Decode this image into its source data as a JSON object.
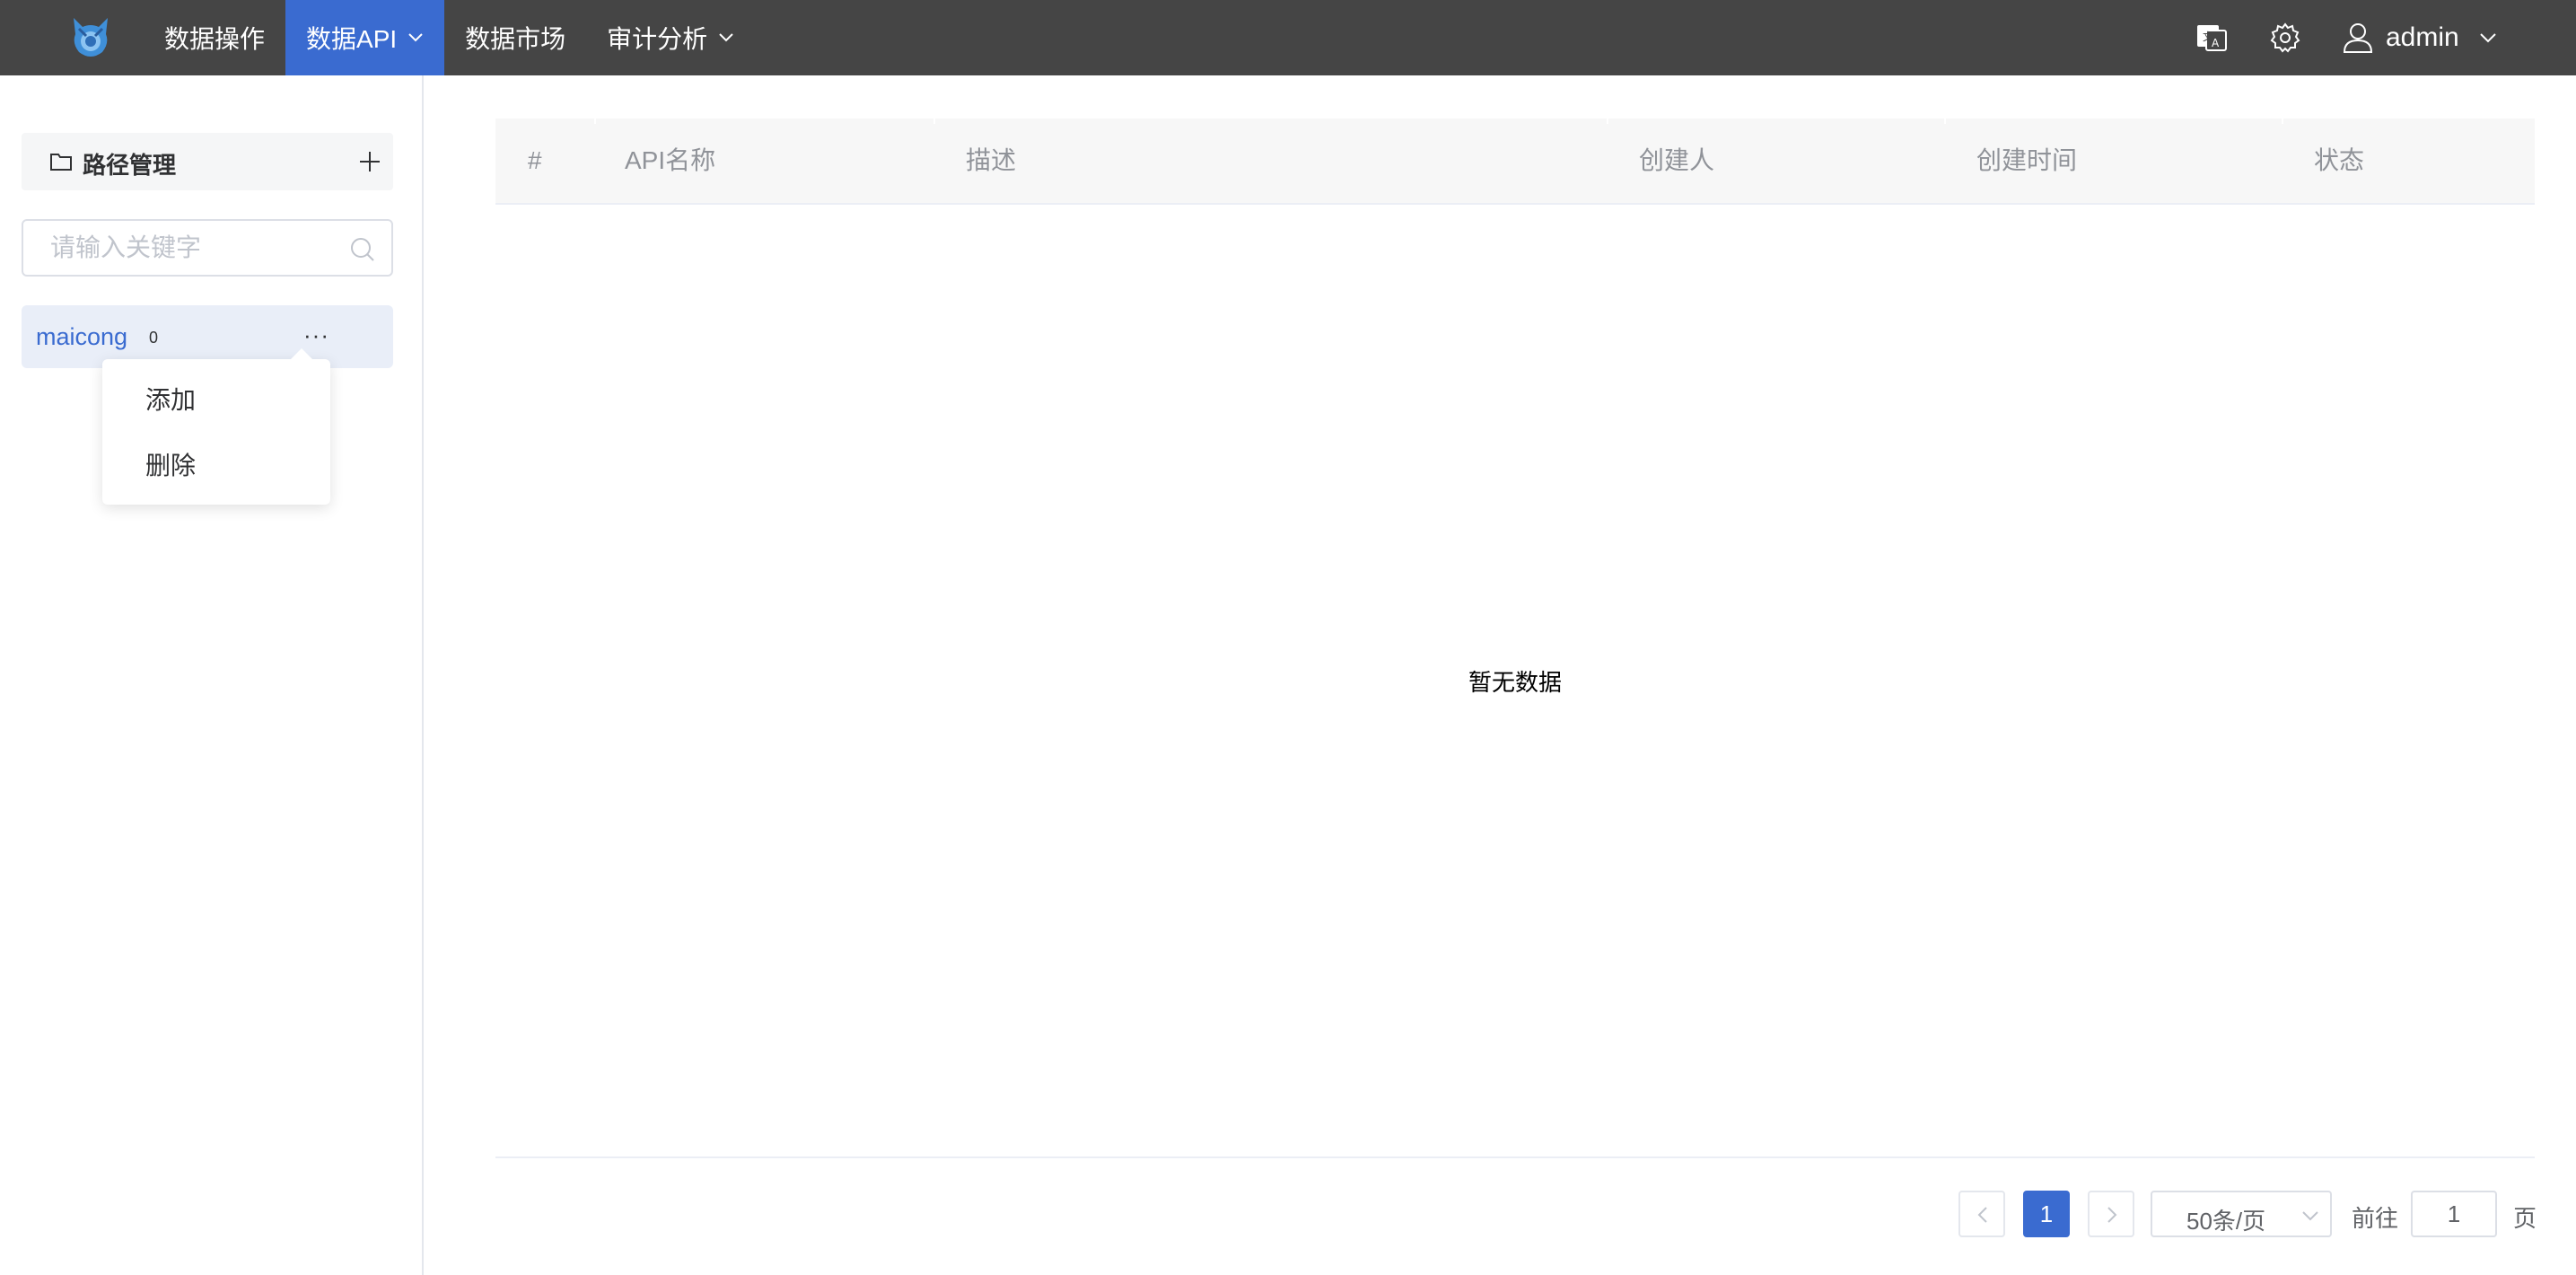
{
  "topbar": {
    "nav": [
      {
        "label": "数据操作",
        "active": false,
        "has_dropdown": false
      },
      {
        "label": "数据API",
        "active": true,
        "has_dropdown": true
      },
      {
        "label": "数据市场",
        "active": false,
        "has_dropdown": false
      },
      {
        "label": "审计分析",
        "active": false,
        "has_dropdown": true
      }
    ],
    "icons": [
      "translate-icon",
      "gear-icon",
      "user-icon"
    ],
    "username": "admin"
  },
  "sidebar": {
    "title": "路径管理",
    "search_placeholder": "请输入关键字",
    "tree": [
      {
        "name": "maicong",
        "count": "0",
        "more": "···"
      }
    ],
    "popup_menu": [
      "添加",
      "删除"
    ]
  },
  "table": {
    "columns": [
      "#",
      "API名称",
      "描述",
      "创建人",
      "创建时间",
      "状态"
    ],
    "empty_text": "暂无数据"
  },
  "pagination": {
    "current_page": "1",
    "page_size": "50条/页",
    "goto_label": "前往",
    "goto_value": "1",
    "goto_suffix": "页"
  },
  "colors": {
    "topbar_bg": "#454545",
    "accent": "#3a6bd0",
    "selected_node_bg": "#e9eef8"
  }
}
